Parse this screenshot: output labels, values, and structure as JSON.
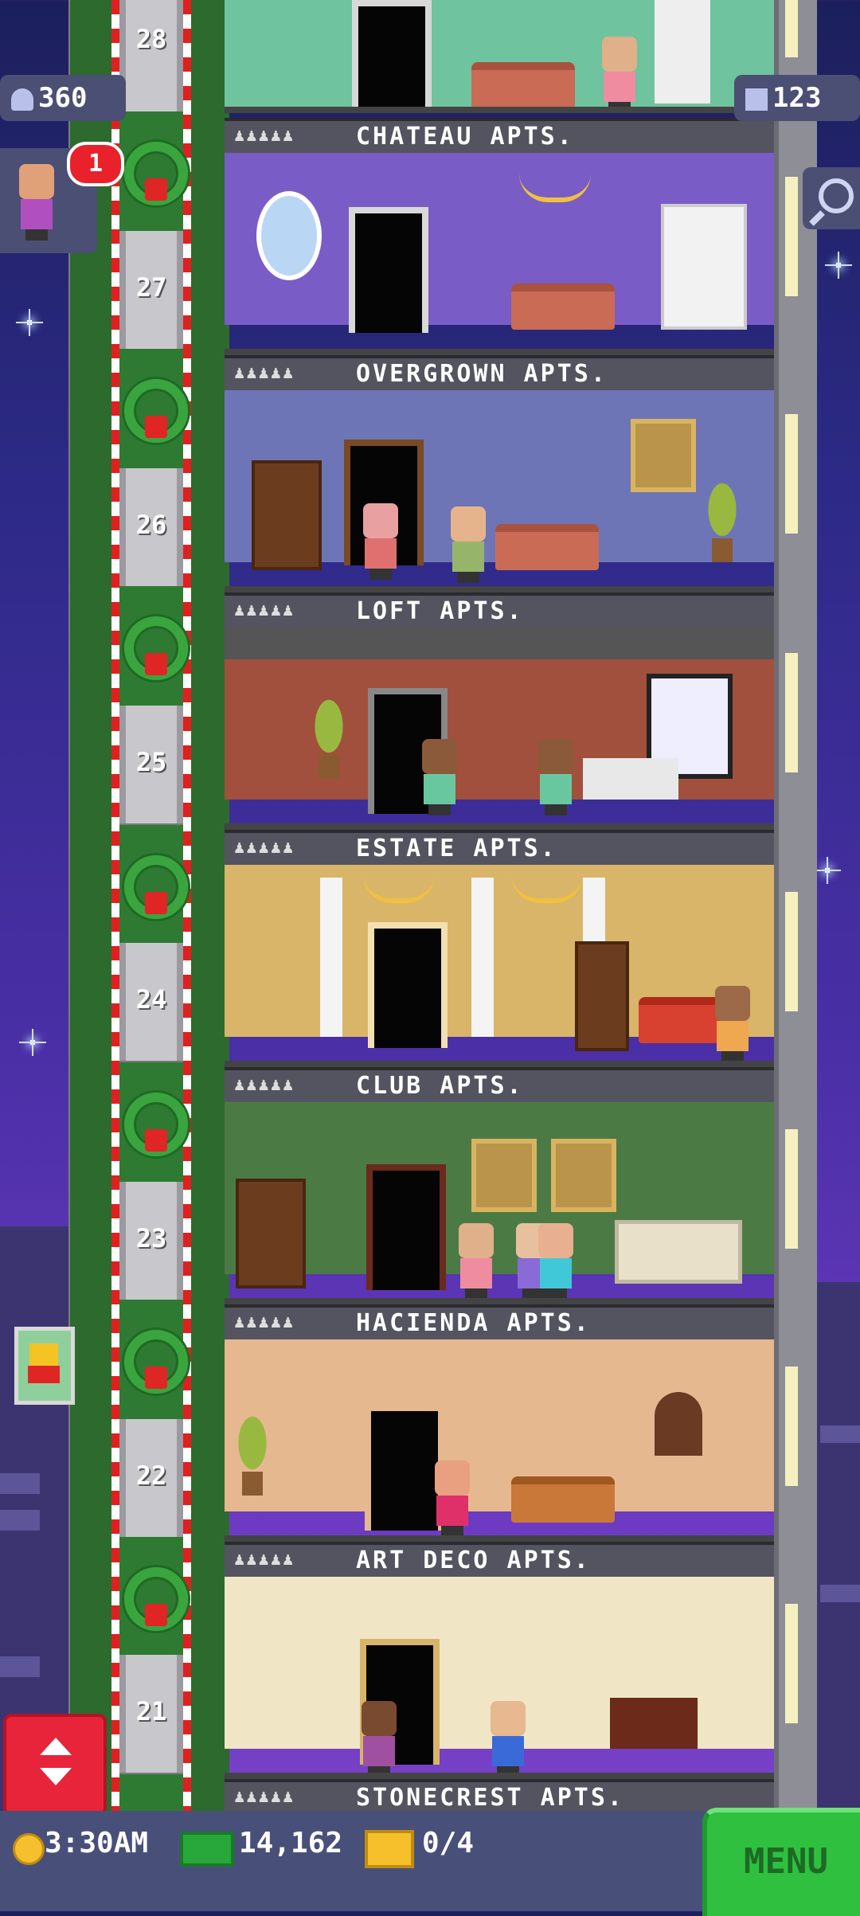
{
  "hud": {
    "population": "360",
    "floors_count": "123",
    "notification_count": "1"
  },
  "elevator": {
    "floor_numbers": [
      "28",
      "27",
      "26",
      "25",
      "24",
      "23",
      "22",
      "21"
    ]
  },
  "floors": [
    {
      "name": "CHATEAU APTS.",
      "residents_icon": "♟♟♟♟♟"
    },
    {
      "name": "OVERGROWN APTS.",
      "residents_icon": "♟♟♟♟♟"
    },
    {
      "name": "LOFT APTS.",
      "residents_icon": "♟♟♟♟♟"
    },
    {
      "name": "ESTATE APTS.",
      "residents_icon": "♟♟♟♟♟"
    },
    {
      "name": "CLUB APTS.",
      "residents_icon": "♟♟♟♟♟"
    },
    {
      "name": "HACIENDA APTS.",
      "residents_icon": "♟♟♟♟♟"
    },
    {
      "name": "ART DECO APTS.",
      "residents_icon": "♟♟♟♟♟"
    },
    {
      "name": "STONECREST APTS.",
      "residents_icon": "♟♟♟♟♟"
    }
  ],
  "bottom_bar": {
    "time": "3:30AM",
    "coins": "14,162",
    "bux": "0/4",
    "menu_label": "MENU"
  },
  "icons": {
    "population": "person-icon",
    "floors": "building-icon",
    "search": "magnifier-icon",
    "elevator": "up-down-arrow-icon",
    "coin": "coin-icon",
    "cash": "cash-icon",
    "bux": "ticket-icon"
  },
  "colors": {
    "menu_green": "#2fc040",
    "elevator_red": "#e8243a",
    "badge_red": "#e8212b",
    "hud_bg": "#4b4f74"
  }
}
